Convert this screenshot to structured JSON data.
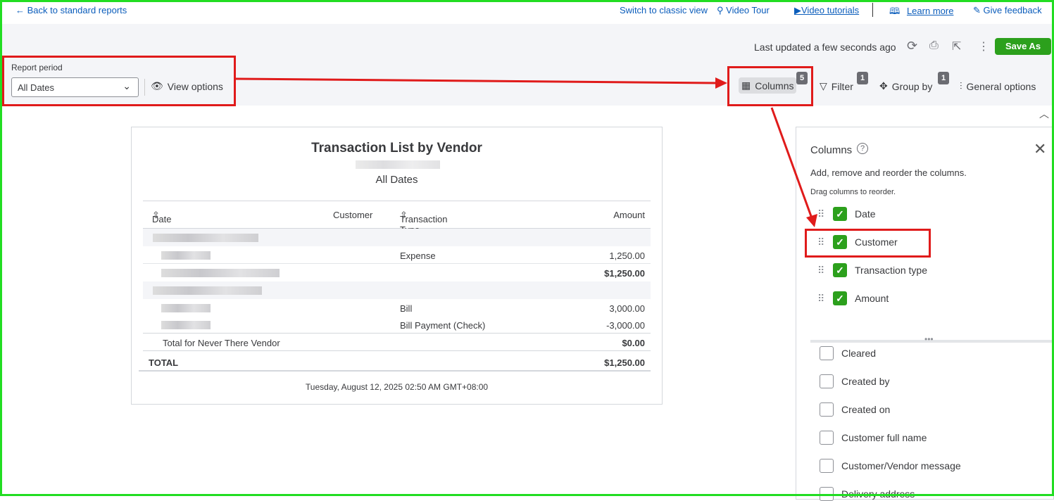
{
  "topbar": {
    "back": "Back to standard reports",
    "classic": "Switch to classic view",
    "video_tour": "Video Tour",
    "video_tutorials": "Video tutorials",
    "learn_more": "Learn more",
    "feedback": "Give feedback"
  },
  "header": {
    "last_updated": "Last updated a few seconds ago",
    "save_as": "Save As"
  },
  "filters": {
    "report_period_label": "Report period",
    "report_period_value": "All Dates",
    "view_options": "View options"
  },
  "toolbar": {
    "columns": "Columns",
    "columns_badge": "5",
    "filter": "Filter",
    "filter_badge": "1",
    "group_by": "Group by",
    "group_by_badge": "1",
    "general_options": "General options"
  },
  "report": {
    "title": "Transaction List by Vendor",
    "period": "All Dates",
    "headers": {
      "date": "Date",
      "customer": "Customer",
      "type": "Transaction Type",
      "amount": "Amount"
    },
    "rows": [
      {
        "type": "Expense",
        "amount": "1,250.00"
      },
      {
        "subtotal": "$1,250.00"
      },
      {
        "type": "Bill",
        "amount": "3,000.00"
      },
      {
        "type": "Bill Payment (Check)",
        "amount": "-3,000.00"
      }
    ],
    "vendor_total_label": "Total for Never There Vendor",
    "vendor_total": "$0.00",
    "total_label": "TOTAL",
    "total": "$1,250.00",
    "footer": "Tuesday, August 12, 2025 02:50 AM GMT+08:00"
  },
  "panel": {
    "title": "Columns",
    "subtitle": "Add, remove and reorder the columns.",
    "hint": "Drag columns to reorder.",
    "selected": [
      "Date",
      "Customer",
      "Transaction type",
      "Amount"
    ],
    "available": [
      "Cleared",
      "Created by",
      "Created on",
      "Customer full name",
      "Customer/Vendor message",
      "Delivery address"
    ]
  },
  "colors": {
    "accent": "#2ca01c",
    "annotation": "#e01b1b",
    "link": "#0b5dbb"
  }
}
